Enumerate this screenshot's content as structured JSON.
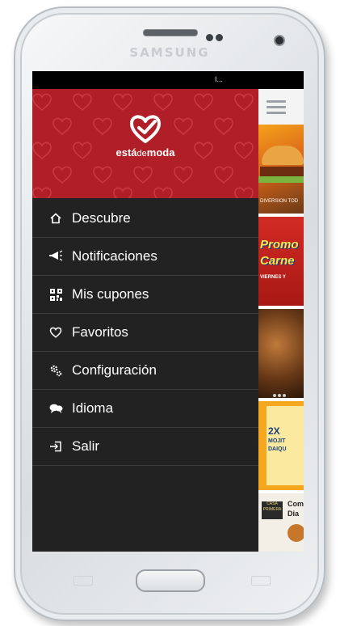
{
  "device": {
    "brand": "SAMSUNG"
  },
  "statusbar": {
    "text": "I..."
  },
  "header": {
    "logo_text_start": "está",
    "logo_text_mid": "de",
    "logo_text_end": "moda",
    "bg_color": "#b01f27"
  },
  "menu": {
    "items": [
      {
        "label": "Descubre",
        "icon": "home-outline-icon"
      },
      {
        "label": "Notificaciones",
        "icon": "megaphone-icon"
      },
      {
        "label": "Mis cupones",
        "icon": "qr-code-icon"
      },
      {
        "label": "Favoritos",
        "icon": "heart-outline-icon"
      },
      {
        "label": "Configuración",
        "icon": "gears-icon"
      },
      {
        "label": "Idioma",
        "icon": "speech-bubbles-icon"
      },
      {
        "label": "Salir",
        "icon": "logout-icon"
      }
    ]
  },
  "background_app": {
    "menu_icon": "hamburger-icon",
    "cards": [
      {
        "caption": "DIVERSION TOD"
      },
      {
        "line1": "Promo",
        "line2": "Carne",
        "line3": "VIERNES Y"
      },
      {
        "caption": ""
      },
      {
        "big": "2X",
        "line1": "MOJIT",
        "line2": "DAIQU"
      },
      {
        "logo": "CASA PRIMERA",
        "line1": "Com",
        "line2": "Dia"
      }
    ]
  }
}
